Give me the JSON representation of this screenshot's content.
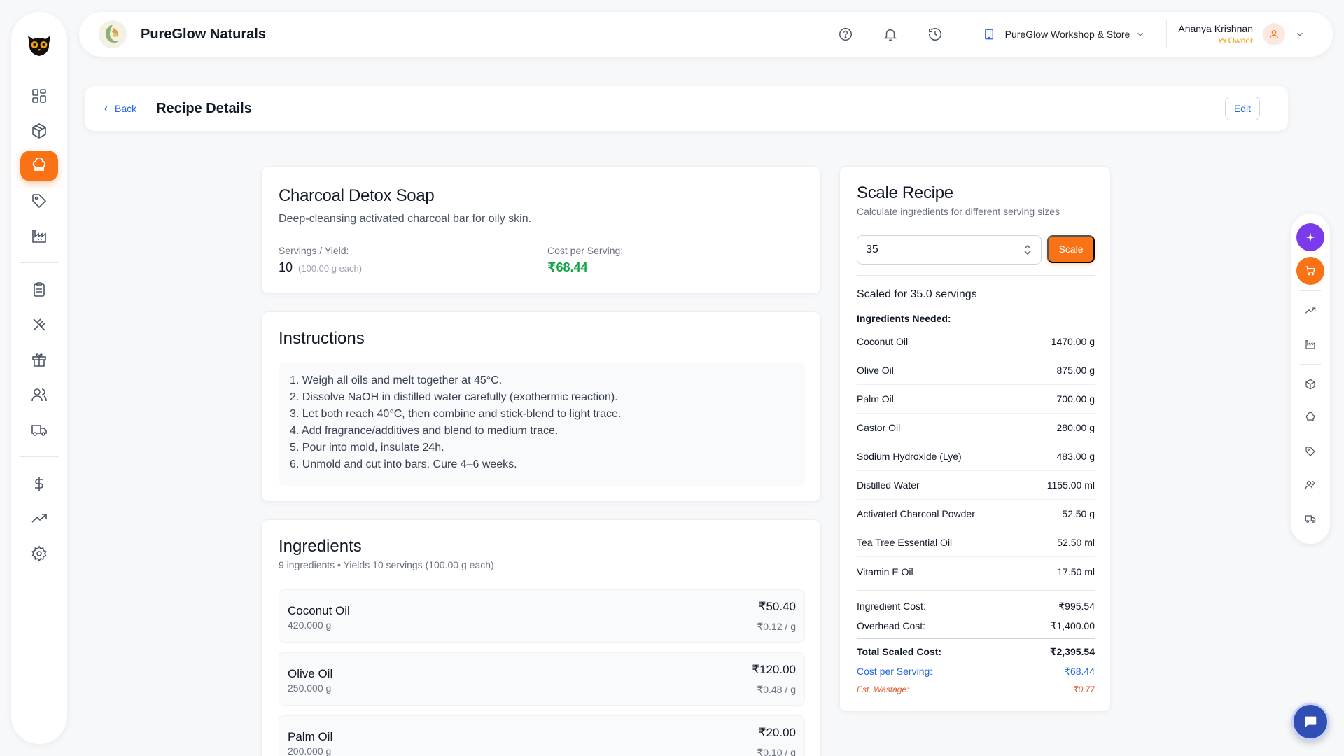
{
  "app": {
    "brand_name": "PureGlow Naturals",
    "store_name": "PureGlow Workshop & Store",
    "user_name": "Ananya Krishnan",
    "user_role": "Owner"
  },
  "page": {
    "back_label": "Back",
    "title": "Recipe Details",
    "edit_label": "Edit"
  },
  "recipe": {
    "name": "Charcoal Detox Soap",
    "description": "Deep-cleansing activated charcoal bar for oily skin.",
    "servings_label": "Servings / Yield:",
    "servings_value": "10",
    "servings_each": "(100.00 g each)",
    "cost_label": "Cost per Serving:",
    "cost_value": "₹68.44"
  },
  "instructions": {
    "title": "Instructions",
    "steps": [
      "1. Weigh all oils and melt together at 45°C.",
      "2. Dissolve NaOH in distilled water carefully (exothermic reaction).",
      "3. Let both reach 40°C, then combine and stick-blend to light trace.",
      "4. Add fragrance/additives and blend to medium trace.",
      "5. Pour into mold, insulate 24h.",
      "6. Unmold and cut into bars. Cure 4–6 weeks."
    ]
  },
  "ingredients": {
    "title": "Ingredients",
    "subtitle": "9 ingredients • Yields 10 servings (100.00 g each)",
    "items": [
      {
        "name": "Coconut Oil",
        "qty": "420.000 g",
        "price": "₹50.40",
        "unit": "₹0.12 / g"
      },
      {
        "name": "Olive Oil",
        "qty": "250.000 g",
        "price": "₹120.00",
        "unit": "₹0.48 / g"
      },
      {
        "name": "Palm Oil",
        "qty": "200.000 g",
        "price": "₹20.00",
        "unit": "₹0.10 / g"
      }
    ]
  },
  "scale": {
    "title": "Scale Recipe",
    "subtitle": "Calculate ingredients for different serving sizes",
    "input_value": "35",
    "button_label": "Scale",
    "scaled_for": "Scaled for 35.0 servings",
    "needed_label": "Ingredients Needed:",
    "rows": [
      {
        "name": "Coconut Oil",
        "amount": "1470.00 g"
      },
      {
        "name": "Olive Oil",
        "amount": "875.00 g"
      },
      {
        "name": "Palm Oil",
        "amount": "700.00 g"
      },
      {
        "name": "Castor Oil",
        "amount": "280.00 g"
      },
      {
        "name": "Sodium Hydroxide (Lye)",
        "amount": "483.00 g"
      },
      {
        "name": "Distilled Water",
        "amount": "1155.00 ml"
      },
      {
        "name": "Activated Charcoal Powder",
        "amount": "52.50 g"
      },
      {
        "name": "Tea Tree Essential Oil",
        "amount": "52.50 ml"
      },
      {
        "name": "Vitamin E Oil",
        "amount": "17.50 ml"
      }
    ],
    "ingredient_cost_label": "Ingredient Cost:",
    "ingredient_cost": "₹995.54",
    "overhead_cost_label": "Overhead Cost:",
    "overhead_cost": "₹1,400.00",
    "total_label": "Total Scaled Cost:",
    "total": "₹2,395.54",
    "cps_label": "Cost per Serving:",
    "cps": "₹68.44",
    "wastage_label": "Est. Wastage:",
    "wastage": "₹0.77"
  },
  "colors": {
    "accent": "#f97316",
    "link": "#2563eb",
    "success": "#16a34a",
    "purple": "#7c3aed"
  },
  "icons": {
    "sidebar": [
      "dashboard-icon",
      "package-icon",
      "chef-hat-icon",
      "tag-icon",
      "factory-icon",
      "clipboard-icon",
      "utensils-icon",
      "gift-icon",
      "users-icon",
      "truck-icon",
      "dollar-icon",
      "trending-icon",
      "settings-icon"
    ],
    "rail": [
      "sparkle-icon",
      "cart-icon",
      "trending-icon",
      "factory-icon",
      "package-icon",
      "chef-hat-icon",
      "tag-icon",
      "users-icon",
      "truck-icon"
    ]
  }
}
